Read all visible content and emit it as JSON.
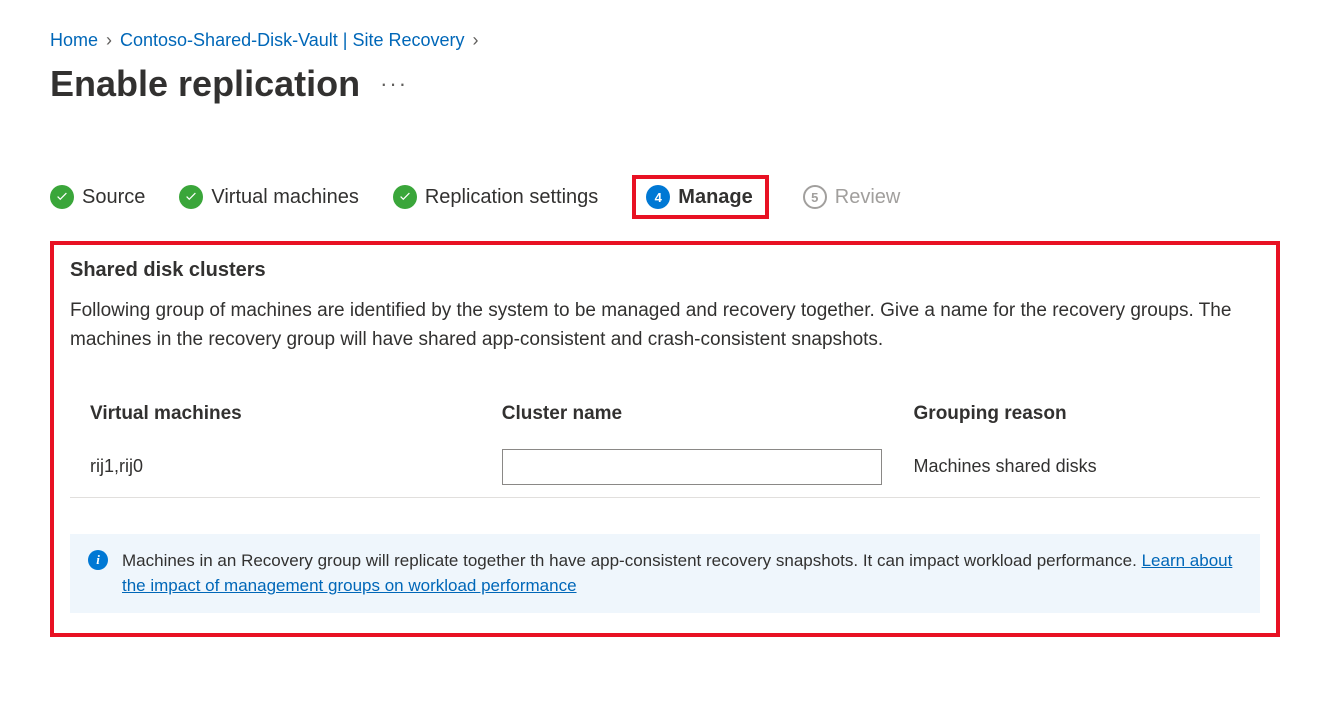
{
  "breadcrumb": {
    "home": "Home",
    "vault": "Contoso-Shared-Disk-Vault | Site Recovery"
  },
  "page_title": "Enable replication",
  "steps": {
    "source": "Source",
    "vm": "Virtual machines",
    "replication": "Replication settings",
    "manage": "Manage",
    "manage_num": "4",
    "review": "Review",
    "review_num": "5"
  },
  "panel": {
    "heading": "Shared disk clusters",
    "desc": "Following group of machines are identified by the system to be managed and recovery together. Give a name for the recovery groups. The machines in the recovery group will have shared app-consistent and crash-consistent snapshots."
  },
  "table": {
    "headers": {
      "vm": "Virtual machines",
      "cluster": "Cluster name",
      "reason": "Grouping reason"
    },
    "row": {
      "vm": "rij1,rij0",
      "cluster_value": "",
      "reason": "Machines shared disks"
    }
  },
  "info": {
    "text": "Machines in an Recovery group will replicate together th have app-consistent recovery snapshots. It can impact workload performance. ",
    "link": "Learn about the impact of management groups on workload performance"
  }
}
